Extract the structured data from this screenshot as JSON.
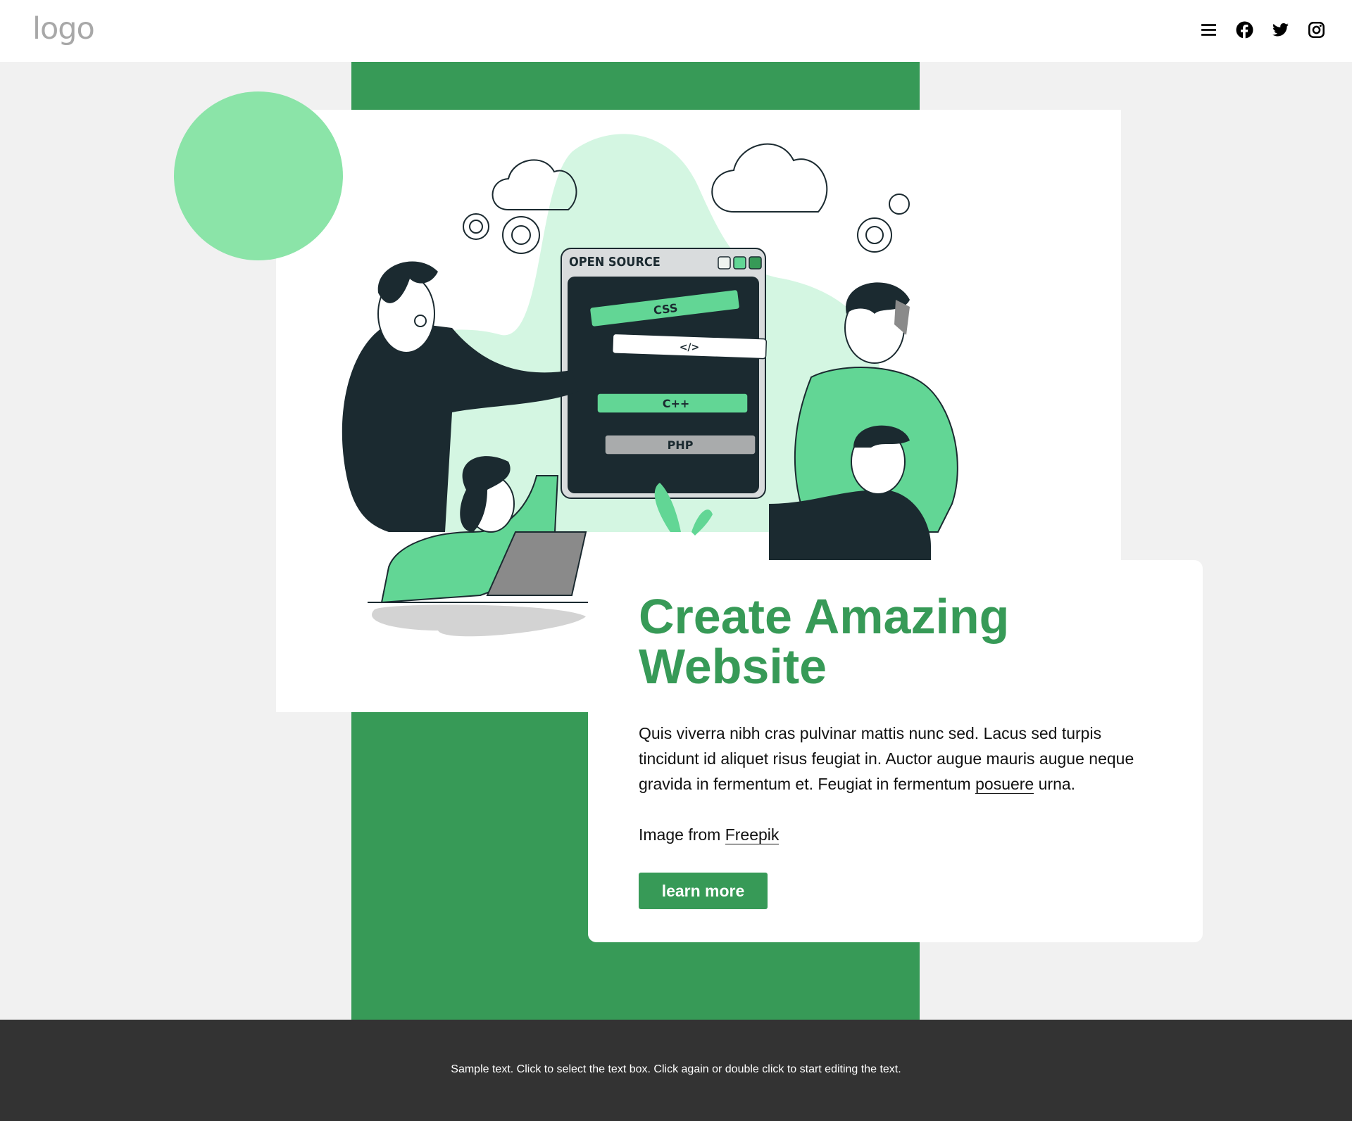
{
  "header": {
    "logo_text": "logo",
    "icons": [
      "menu-icon",
      "facebook-icon",
      "twitter-icon",
      "instagram-icon"
    ]
  },
  "illustration": {
    "window_title": "OPEN SOURCE",
    "tags": [
      "CSS",
      "</>",
      "C++",
      "PHP"
    ]
  },
  "card": {
    "title": "Create Amazing Website",
    "body_before_link": "Quis viverra nibh cras pulvinar mattis nunc sed. Lacus sed turpis tincidunt id aliquet risus feugiat in. Auctor augue mauris augue neque gravida in fermentum et. Feugiat in fermentum ",
    "body_link": "posuere",
    "body_after_link": " urna.",
    "credit_prefix": "Image from ",
    "credit_link": "Freepik",
    "button_label": "learn more"
  },
  "footer": {
    "text": "Sample text. Click to select the text box. Click again or double click to start editing the text."
  },
  "colors": {
    "brand_green": "#379a57",
    "light_green": "#8be4a8",
    "illustration_green": "#62d695",
    "dark": "#1b2a30",
    "footer_bg": "#333333",
    "page_bg": "#f1f1f1"
  }
}
